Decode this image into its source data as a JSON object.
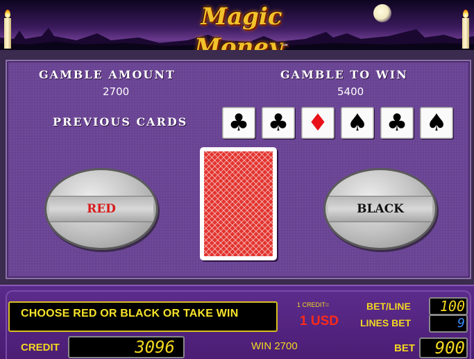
{
  "header": {
    "logo_text": "Magic Money",
    "trademark": "™"
  },
  "gamble": {
    "amount_label": "GAMBLE AMOUNT",
    "amount_value": "2700",
    "to_win_label": "GAMBLE TO WIN",
    "to_win_value": "5400",
    "previous_cards_label": "PREVIOUS CARDS",
    "previous_cards": [
      {
        "suit": "clubs",
        "glyph": "♣",
        "color": "#000000"
      },
      {
        "suit": "clubs",
        "glyph": "♣",
        "color": "#000000"
      },
      {
        "suit": "diamonds",
        "glyph": "♦",
        "color": "#e8111a"
      },
      {
        "suit": "spades",
        "glyph": "♠",
        "color": "#000000"
      },
      {
        "suit": "clubs",
        "glyph": "♣",
        "color": "#000000"
      },
      {
        "suit": "spades",
        "glyph": "♠",
        "color": "#000000"
      }
    ]
  },
  "buttons": {
    "red_label": "RED",
    "black_label": "BLACK"
  },
  "status": {
    "message": "CHOOSE RED OR BLACK OR TAKE WIN",
    "credit_equals_label": "1 CREDIT=",
    "credit_equals_value": "1 USD",
    "credit_label": "CREDIT",
    "credit_value": "3096",
    "win_label": "WIN 2700",
    "bet_line_label": "BET/LINE",
    "bet_line_value": "100",
    "lines_bet_label": "LINES BET",
    "lines_bet_value": "9",
    "bet_label": "BET",
    "bet_value": "900"
  },
  "colors": {
    "panel": "#6a4494",
    "accent_yellow": "#f2d820",
    "red_text": "#d81a1a",
    "card_back": "#e3342f"
  }
}
